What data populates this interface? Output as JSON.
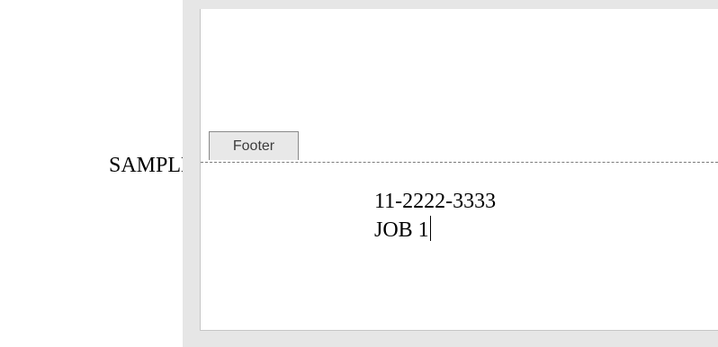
{
  "sample_label": "SAMPLE:",
  "footer": {
    "tab_label": "Footer",
    "lines": [
      "11-2222-3333",
      "JOB 1"
    ]
  }
}
